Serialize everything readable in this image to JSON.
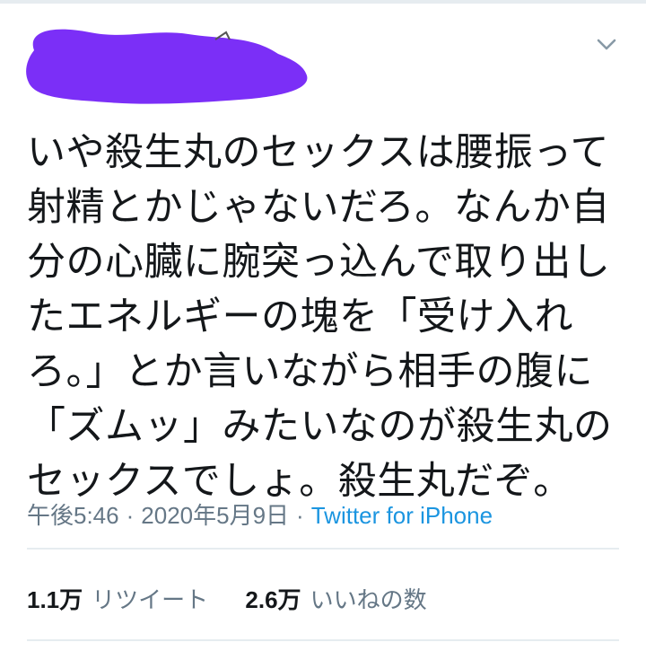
{
  "tweet": {
    "text": "いや殺生丸のセックスは腰振って\n射精とかじゃないだろ。なんか自\n分の心臓に腕突っ込んで取り出し\nたエネルギーの塊を「受け入れ\nろ。」とか言いながら相手の腹に\n「ズムッ」みたいなのが殺生丸の\nセックスでしょ。殺生丸だぞ。",
    "time": "午後5:46",
    "date": "2020年5月9日",
    "separator": "·",
    "source": "Twitter for iPhone"
  },
  "stats": {
    "retweets_count": "1.1万",
    "retweets_label": "リツイート",
    "likes_count": "2.6万",
    "likes_label": "いいねの数"
  },
  "icons": {
    "menu": "chevron-down-icon"
  },
  "colors": {
    "text": "#14171a",
    "secondary": "#657786",
    "link": "#1b95e0",
    "divider": "#e6ecf0",
    "redaction": "#7b2ff7"
  }
}
